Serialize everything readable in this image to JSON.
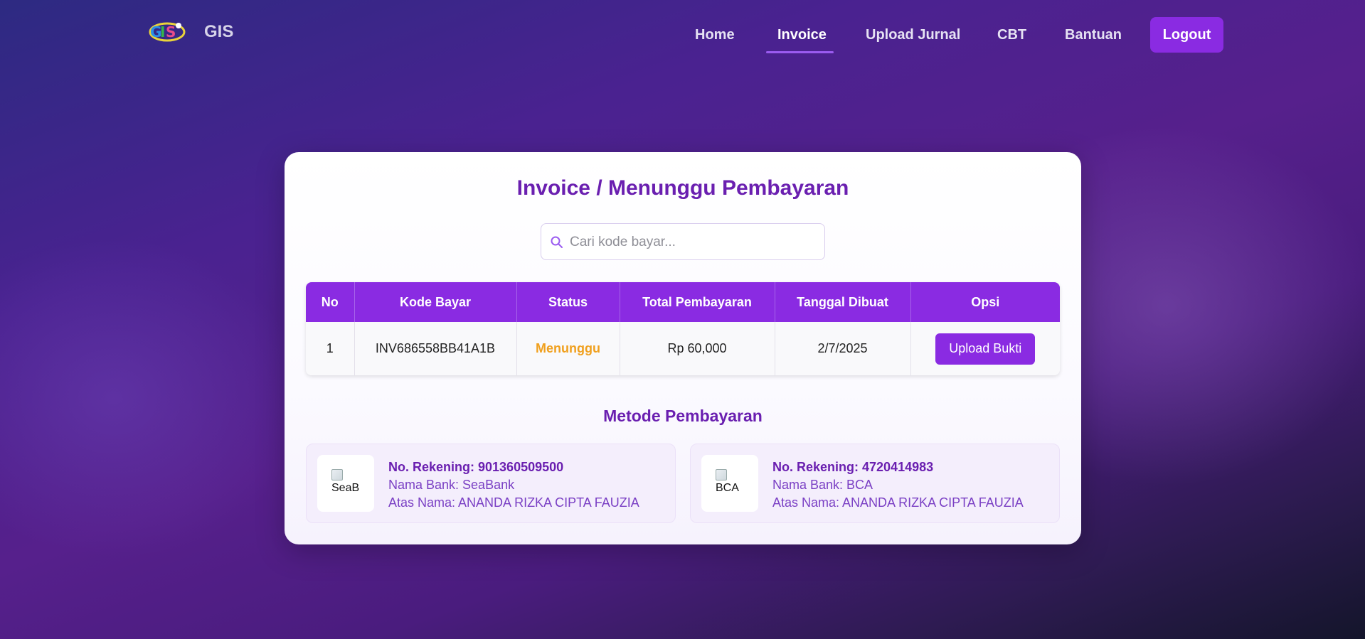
{
  "navbar": {
    "brand": "GIS",
    "links": [
      {
        "label": "Home"
      },
      {
        "label": "Invoice"
      },
      {
        "label": "Upload Jurnal"
      },
      {
        "label": "CBT"
      },
      {
        "label": "Bantuan"
      }
    ],
    "active": "Invoice",
    "logout_label": "Logout"
  },
  "page": {
    "title": "Invoice / Menunggu Pembayaran",
    "search_placeholder": "Cari kode bayar..."
  },
  "table": {
    "headers": [
      "No",
      "Kode Bayar",
      "Status",
      "Total Pembayaran",
      "Tanggal Dibuat",
      "Opsi"
    ],
    "rows": [
      {
        "no": "1",
        "kode": "INV686558BB41A1B",
        "status": "Menunggu",
        "total": "Rp 60,000",
        "tanggal": "2/7/2025",
        "action": "Upload Bukti"
      }
    ]
  },
  "methods": {
    "title": "Metode Pembayaran",
    "banks": [
      {
        "logo_alt": "SeaB",
        "account": "No. Rekening: 901360509500",
        "bank": "Nama Bank: SeaBank",
        "owner": "Atas Nama: ANANDA RIZKA CIPTA FAUZIA"
      },
      {
        "logo_alt": "BCA",
        "account": "No. Rekening: 4720414983",
        "bank": "Nama Bank: BCA",
        "owner": "Atas Nama: ANANDA RIZKA CIPTA FAUZIA"
      }
    ]
  },
  "colors": {
    "accent": "#8a2be2",
    "title": "#6a1fb0",
    "status_pending": "#f0a01e"
  }
}
